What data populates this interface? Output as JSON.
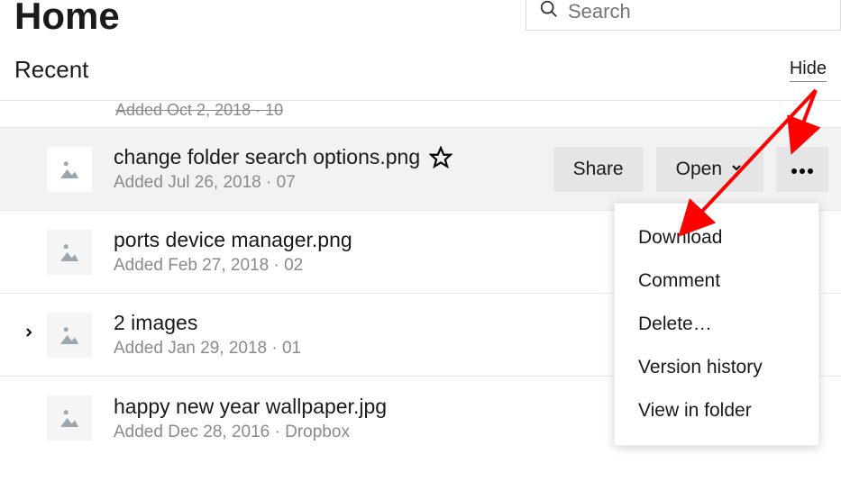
{
  "header": {
    "title": "Home",
    "search_placeholder": "Search"
  },
  "section": {
    "title": "Recent",
    "hide_label": "Hide"
  },
  "cutoff_text": "Added Oct 2, 2018 · 10",
  "files": [
    {
      "name": "change folder search options.png",
      "sub": "Added Jul 26, 2018 · 07",
      "selected": true,
      "starred": false,
      "expandable": false
    },
    {
      "name": "ports device manager.png",
      "sub": "Added Feb 27, 2018 · 02",
      "selected": false,
      "expandable": false
    },
    {
      "name": "2 images",
      "sub": "Added Jan 29, 2018 · 01",
      "selected": false,
      "expandable": true
    },
    {
      "name": "happy new year wallpaper.jpg",
      "sub": "Added Dec 28, 2016 · Dropbox",
      "selected": false,
      "expandable": false
    }
  ],
  "actions": {
    "share": "Share",
    "open": "Open"
  },
  "menu": [
    "Download",
    "Comment",
    "Delete…",
    "Version history",
    "View in folder"
  ]
}
